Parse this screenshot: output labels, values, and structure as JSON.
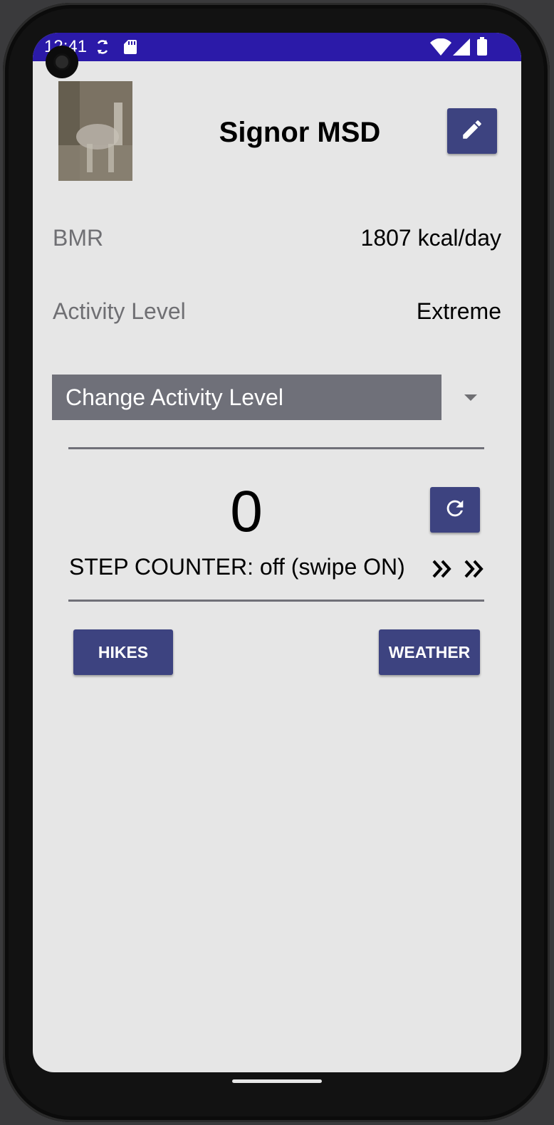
{
  "status_bar": {
    "time": "12:41",
    "icons": [
      "sync-icon",
      "sd-card-icon",
      "wifi-icon",
      "signal-icon",
      "battery-icon"
    ],
    "background_color": "#2b1aa8"
  },
  "profile": {
    "name": "Signor MSD",
    "edit_icon": "pencil-icon"
  },
  "stats": {
    "bmr_label": "BMR",
    "bmr_value": "1807 kcal/day",
    "activity_label": "Activity Level",
    "activity_value": "Extreme"
  },
  "activity_select": {
    "selected": "Change Activity Level"
  },
  "step_counter": {
    "count": "0",
    "status_text": "STEP COUNTER: off (swipe ON)",
    "reset_icon": "refresh-icon",
    "swipe_icon": "double-chevron-right-icon"
  },
  "actions": {
    "hikes_label": "HIKES",
    "weather_label": "WEATHER"
  },
  "colors": {
    "accent": "#3d4380",
    "screen_background": "#e6e6e6",
    "dropdown_background": "#6f7079"
  }
}
